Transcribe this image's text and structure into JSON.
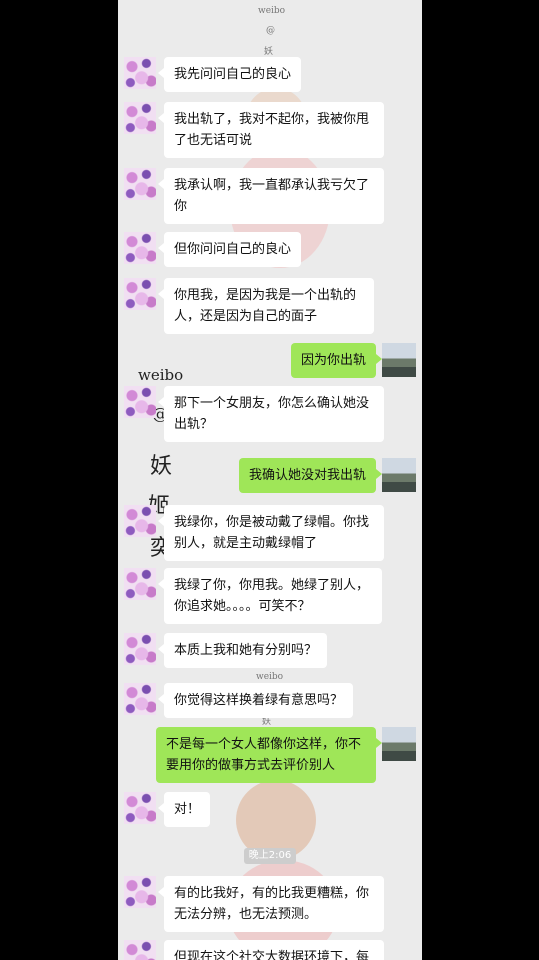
{
  "watermarks": {
    "weibo_top": "weibo",
    "at_top": "@",
    "yao_top": "妖",
    "weibo_mid": "weibo",
    "at_mid": "@",
    "yao_1": "妖",
    "yao_2": "姬",
    "yao_3": "奕",
    "weibo_low": "weibo",
    "yao_low": "妖"
  },
  "timestamp": "晚上2:06",
  "messages": [
    {
      "side": "in",
      "text": "我先问问自己的良心"
    },
    {
      "side": "in",
      "text": "我出轨了，我对不起你，我被你甩了也无话可说"
    },
    {
      "side": "in",
      "text": "我承认啊，我一直都承认我亏欠了你"
    },
    {
      "side": "in",
      "text": "但你问问自己的良心"
    },
    {
      "side": "in",
      "text": "你甩我，是因为我是一个出轨的人，还是因为自己的面子"
    },
    {
      "side": "out",
      "text": "因为你出轨"
    },
    {
      "side": "in",
      "text": "那下一个女朋友，你怎么确认她没出轨？"
    },
    {
      "side": "out",
      "text": "我确认她没对我出轨"
    },
    {
      "side": "in",
      "text": "我绿你，你是被动戴了绿帽。你找别人，就是主动戴绿帽了"
    },
    {
      "side": "in",
      "text": "我绿了你，你甩我。她绿了别人，你追求她。。。。可笑不？"
    },
    {
      "side": "in",
      "text": "本质上我和她有分别吗？"
    },
    {
      "side": "in",
      "text": "你觉得这样换着绿有意思吗？"
    },
    {
      "side": "out",
      "text": "不是每一个女人都像你这样，你不要用你的做事方式去评价别人"
    },
    {
      "side": "in",
      "text": "对！"
    },
    {
      "side": "in",
      "text": "有的比我好，有的比我更糟糕，你无法分辨，也无法预测。"
    },
    {
      "side": "in",
      "text": "但现在这个社交大数据环境下，每"
    }
  ]
}
